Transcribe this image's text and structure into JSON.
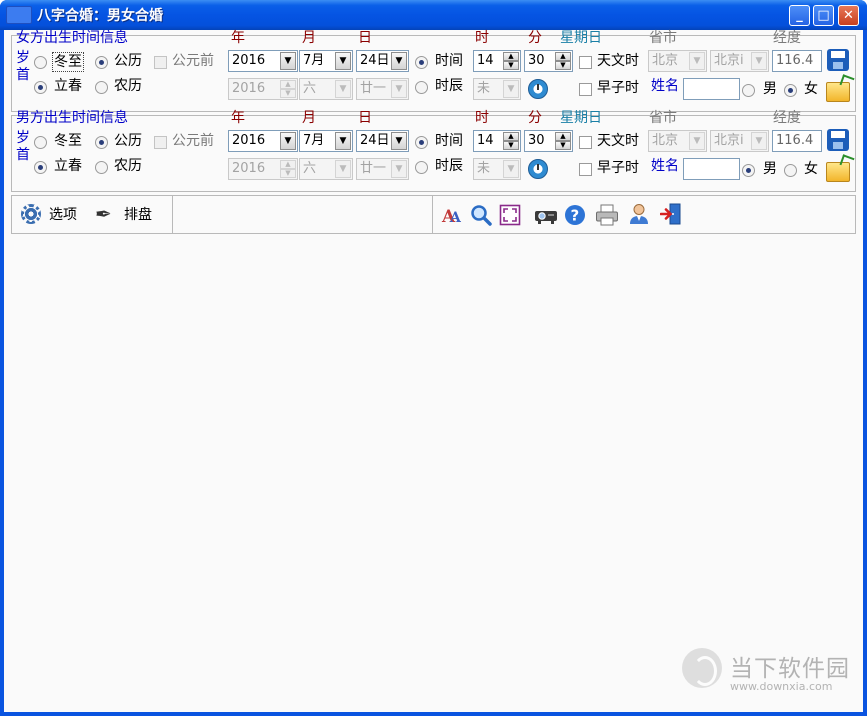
{
  "window": {
    "title": "八字合婚：男女合婚",
    "minimize": "_",
    "maximize": "□",
    "close": "✕"
  },
  "female": {
    "heading": "女方出生时间信息",
    "yearstart_label": "岁首",
    "dongzhi": "冬至",
    "lichun": "立春",
    "gongli": "公历",
    "nongli": "农历",
    "gongyuanqian": "公元前",
    "col_year": "年",
    "col_month": "月",
    "col_day": "日",
    "col_hour": "时",
    "col_minute": "分",
    "col_weekday": "星期日",
    "col_province_city": "省市",
    "col_longitude": "经度",
    "year_value": "2016",
    "month_value": "7月",
    "day_value": "24日",
    "lunar_year": "2016",
    "lunar_month": "六",
    "lunar_day": "廿一",
    "time_label": "时间",
    "shichen_label": "时辰",
    "hour_value": "14",
    "minute_value": "30",
    "shichen_value": "未",
    "tianwen_label": "天文时",
    "zaozi_label": "早子时",
    "province": "北京",
    "city": "北京i",
    "longitude": "116.4",
    "name_label": "姓名",
    "name_value": "",
    "male_label": "男",
    "female_label": "女"
  },
  "male": {
    "heading": "男方出生时间信息",
    "yearstart_label": "岁首",
    "dongzhi": "冬至",
    "lichun": "立春",
    "gongli": "公历",
    "nongli": "农历",
    "gongyuanqian": "公元前",
    "col_year": "年",
    "col_month": "月",
    "col_day": "日",
    "col_hour": "时",
    "col_minute": "分",
    "col_weekday": "星期日",
    "col_province_city": "省市",
    "col_longitude": "经度",
    "year_value": "2016",
    "month_value": "7月",
    "day_value": "24日",
    "lunar_year": "2016",
    "lunar_month": "六",
    "lunar_day": "廿一",
    "time_label": "时间",
    "shichen_label": "时辰",
    "hour_value": "14",
    "minute_value": "30",
    "shichen_value": "未",
    "tianwen_label": "天文时",
    "zaozi_label": "早子时",
    "province": "北京",
    "city": "北京i",
    "longitude": "116.4",
    "name_label": "姓名",
    "name_value": "",
    "male_label": "男",
    "female_label": "女"
  },
  "toolbar": {
    "options_label": "选项",
    "chart_label": "排盘"
  },
  "watermark": {
    "text": "当下软件园",
    "url": "www.downxia.com"
  },
  "icons": [
    "save-icon",
    "folder-open-icon",
    "clock-icon",
    "gear-icon",
    "quill-icon",
    "font-icon",
    "zoom-icon",
    "fullscreen-icon",
    "projector-icon",
    "help-icon",
    "printer-icon",
    "user-icon",
    "exit-icon"
  ]
}
